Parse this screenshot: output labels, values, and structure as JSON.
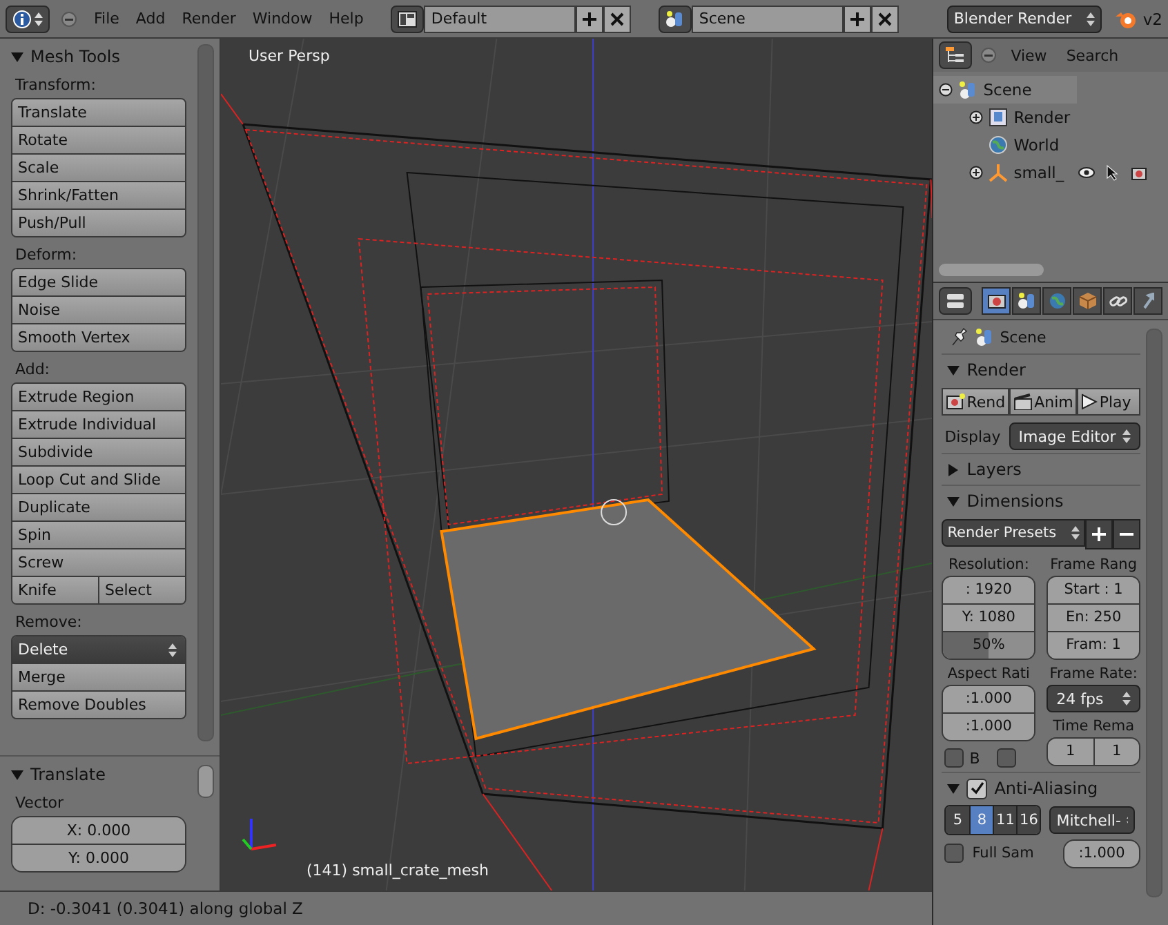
{
  "menu_bar": {
    "menus": [
      "File",
      "Add",
      "Render",
      "Window",
      "Help"
    ],
    "layout": "Default",
    "scene": "Scene",
    "engine": "Blender Render",
    "version": "v2"
  },
  "tool_panel": {
    "title": "Mesh Tools",
    "expanded": true,
    "sections": [
      {
        "label": "Transform:",
        "rows": [
          {
            "kind": "button",
            "labels": [
              "Translate"
            ]
          },
          {
            "kind": "button",
            "labels": [
              "Rotate"
            ]
          },
          {
            "kind": "button",
            "labels": [
              "Scale"
            ]
          },
          {
            "kind": "button",
            "labels": [
              "Shrink/Fatten"
            ]
          },
          {
            "kind": "button",
            "labels": [
              "Push/Pull"
            ]
          }
        ]
      },
      {
        "label": "Deform:",
        "rows": [
          {
            "kind": "button",
            "labels": [
              "Edge Slide"
            ]
          },
          {
            "kind": "button",
            "labels": [
              "Noise"
            ]
          },
          {
            "kind": "button",
            "labels": [
              "Smooth Vertex"
            ]
          }
        ]
      },
      {
        "label": "Add:",
        "rows": [
          {
            "kind": "button",
            "labels": [
              "Extrude Region"
            ]
          },
          {
            "kind": "button",
            "labels": [
              "Extrude Individual"
            ]
          },
          {
            "kind": "button",
            "labels": [
              "Subdivide"
            ]
          },
          {
            "kind": "button",
            "labels": [
              "Loop Cut and Slide"
            ]
          },
          {
            "kind": "button",
            "labels": [
              "Duplicate"
            ]
          },
          {
            "kind": "button",
            "labels": [
              "Spin"
            ]
          },
          {
            "kind": "button",
            "labels": [
              "Screw"
            ]
          },
          {
            "kind": "button",
            "labels": [
              "Knife",
              "Select"
            ]
          }
        ]
      },
      {
        "label": "Remove:",
        "rows": [
          {
            "kind": "dropdown",
            "labels": [
              "Delete"
            ]
          },
          {
            "kind": "button",
            "labels": [
              "Merge"
            ]
          },
          {
            "kind": "button",
            "labels": [
              "Remove Doubles"
            ]
          }
        ]
      }
    ]
  },
  "operator_panel": {
    "title": "Translate",
    "expanded": true,
    "label": "Vector",
    "fields": [
      "X: 0.000",
      "Y: 0.000"
    ]
  },
  "viewport": {
    "view_label": "User Persp",
    "object_label": "(141) small_crate_mesh"
  },
  "status_bar": {
    "text": "D: -0.3041 (0.3041) along global Z"
  },
  "outliner": {
    "menus": [
      "View",
      "Search"
    ],
    "tree": [
      {
        "label": "Scene",
        "kind": "scene",
        "expanded": true,
        "children": [
          {
            "label": "Render",
            "kind": "render",
            "expanded": false
          },
          {
            "label": "World",
            "kind": "world"
          },
          {
            "label": "small_",
            "kind": "mesh",
            "expanded": false
          }
        ]
      }
    ]
  },
  "properties": {
    "tabs": [
      {
        "kind": "render",
        "selected": true
      },
      {
        "kind": "scene",
        "selected": false
      },
      {
        "kind": "world",
        "selected": false
      },
      {
        "kind": "object",
        "selected": false
      },
      {
        "kind": "constraints",
        "selected": false
      },
      {
        "kind": "modifiers",
        "selected": false
      }
    ],
    "context": "Scene",
    "render": {
      "title": "Render",
      "expanded": true,
      "buttons": [
        {
          "kind": "still",
          "label": "Rend"
        },
        {
          "kind": "animation",
          "label": "Anim"
        },
        {
          "kind": "play",
          "label": "Play"
        }
      ],
      "display_label": "Display",
      "display_value": "Image Editor"
    },
    "layers": {
      "title": "Layers",
      "expanded": false
    },
    "dimensions": {
      "title": "Dimensions",
      "expanded": true,
      "presets": "Render Presets",
      "resolution_label": "Resolution:",
      "resolution_fields": [
        ": 1920",
        "Y: 1080"
      ],
      "percentage": {
        "label": "50%",
        "level": 0.5
      },
      "aspect_label": "Aspect Rati",
      "aspect_fields": [
        ":1.000",
        ":1.000"
      ],
      "border_checks": [
        {
          "label": "B",
          "checked": false
        },
        {
          "checked": false
        }
      ],
      "frame_label": "Frame Rang",
      "frame_fields": [
        "Start : 1",
        "En: 250",
        "Fram: 1"
      ],
      "rate_label": "Frame Rate:",
      "rate": "24 fps",
      "remap_label": "Time Rema",
      "remap": [
        "1",
        "1"
      ]
    },
    "anti_aliasing": {
      "title": "Anti-Aliasing",
      "expanded": true,
      "checked": true,
      "samples": [
        {
          "label": "5",
          "selected": false
        },
        {
          "label": "8",
          "selected": true
        },
        {
          "label": "11",
          "selected": false
        },
        {
          "label": "16",
          "selected": false
        }
      ],
      "filter": "Mitchell-",
      "full_sample": {
        "label": "Full Sam",
        "checked": false
      },
      "filter_size": ":1.000"
    }
  }
}
